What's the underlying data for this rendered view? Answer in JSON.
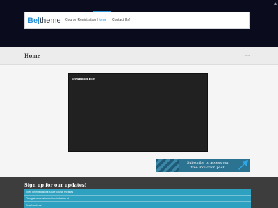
{
  "header": {
    "logo": {
      "be": "Be",
      "theme": "theme"
    },
    "nav": [
      {
        "label": "Course Registration",
        "active": false
      },
      {
        "label": "Home",
        "active": true
      },
      {
        "label": "Contact Us!",
        "active": false
      }
    ]
  },
  "page": {
    "title": "Home",
    "breadcrumb": "Home"
  },
  "video": {
    "title": "Download File"
  },
  "banner": {
    "line1": "Subscribe to access our",
    "line2": "free induction pack",
    "icon": "arrow-icon"
  },
  "signup": {
    "title": "Sign up for our updates!",
    "line1": "Keep informed about future course releases",
    "line2": "Plus gain access to our free induction kit",
    "email_label": "Email Address*"
  },
  "colors": {
    "accent": "#2991d6",
    "header_bg": "#0a0c1e",
    "signup_bg": "#2ea1c0",
    "banner_bg": "#2c7291",
    "footer_bg": "#3d3d3d"
  }
}
